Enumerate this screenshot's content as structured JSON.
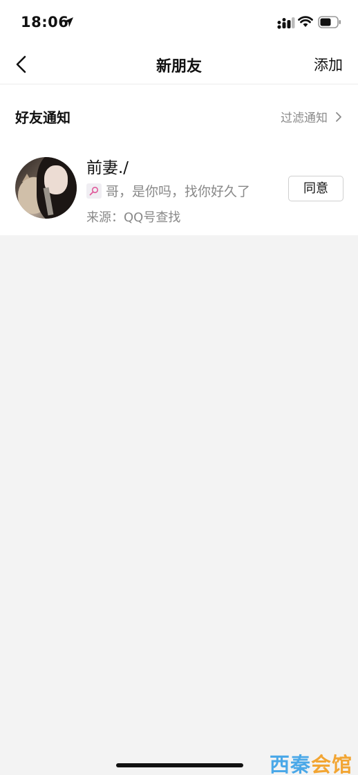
{
  "status_bar": {
    "time": "18:06",
    "icons": [
      "location-arrow-icon",
      "signal-icon",
      "wifi-icon",
      "battery-icon"
    ]
  },
  "nav": {
    "title": "新朋友",
    "add_label": "添加",
    "back_icon": "chevron-left-icon"
  },
  "section": {
    "title": "好友通知",
    "filter_label": "过滤通知"
  },
  "requests": [
    {
      "name": "前妻./",
      "message": "哥，是你吗，找你好久了",
      "source": "来源：QQ号查找",
      "action_label": "同意",
      "source_icon": "search-source-icon"
    }
  ],
  "watermark": {
    "part1": "西秦",
    "part2": "会馆"
  },
  "colors": {
    "background": "#f3f3f3",
    "card": "#ffffff",
    "secondary_text": "#888888",
    "source_icon_accent": "#e05a9a"
  }
}
